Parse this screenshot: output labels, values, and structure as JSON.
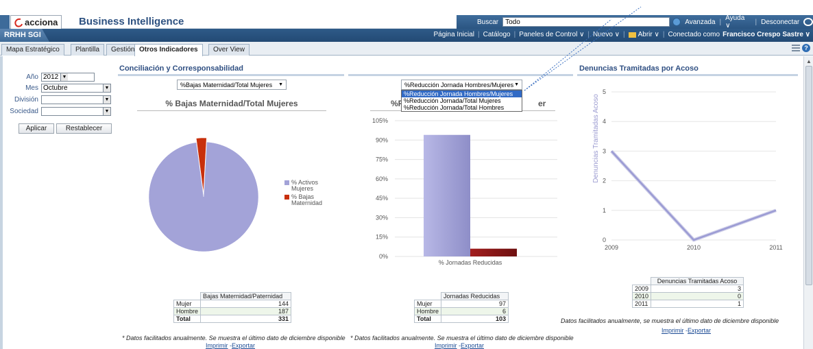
{
  "header": {
    "brand": "acciona",
    "app_title": "Business Intelligence",
    "search_label": "Buscar",
    "search_value": "Todo",
    "links": [
      "Avanzada",
      "Ayuda ∨",
      "Desconectar"
    ]
  },
  "navbar": {
    "section": "RRHH SGI",
    "links": [
      "Página Inicial",
      "Catálogo",
      "Paneles de Control ∨",
      "Nuevo ∨",
      "Abrir ∨"
    ],
    "connected_label": "Conectado como",
    "user": "Francisco Crespo Sastre ∨"
  },
  "tabs": [
    "Mapa Estratégico",
    "Plantilla",
    "Gestión",
    "Otros Indicadores",
    "Over View"
  ],
  "active_tab": "Otros Indicadores",
  "filters": {
    "anio": {
      "label": "Año",
      "value": "2012"
    },
    "mes": {
      "label": "Mes",
      "value": "Octubre"
    },
    "division": {
      "label": "División",
      "value": ""
    },
    "sociedad": {
      "label": "Sociedad",
      "value": ""
    },
    "apply": "Aplicar",
    "reset": "Restablecer"
  },
  "section1": {
    "title": "Conciliación y Corresponsabilidad",
    "selector": "%Bajas Maternidad/Total Mujeres",
    "chart_title": "% Bajas Maternidad/Total Mujeres",
    "legend": [
      "% Activos Mujeres",
      "% Bajas Maternidad"
    ],
    "table": {
      "header": "Bajas Maternidad/Paternidad",
      "rows": [
        {
          "label": "Mujer",
          "value": "144"
        },
        {
          "label": "Hombre",
          "value": "187"
        }
      ],
      "total_label": "Total",
      "total_value": "331"
    },
    "note": "* Datos facilitados anualmente. Se muestra el último dato de diciembre disponible",
    "print": "Imprimir",
    "export": "Exportar"
  },
  "section2": {
    "selector": "%Reducción Jornada Hombres/Mujeres",
    "options": [
      "%Reducción Jornada Hombres/Mujeres",
      "%Reducción Jornada/Total Mujeres",
      "%Reducción Jornada/Total Hombres"
    ],
    "chart_title_left": "%R",
    "chart_title_right": "er",
    "x_label": "% Jornadas Reducidas",
    "table": {
      "header": "Jornadas Reducidas",
      "rows": [
        {
          "label": "Mujer",
          "value": "97"
        },
        {
          "label": "Hombre",
          "value": "6"
        }
      ],
      "total_label": "Total",
      "total_value": "103"
    },
    "note": "* Datos facilitados anualmente. Se muestra el último dato de diciembre disponible",
    "print": "Imprimir",
    "export": "Exportar"
  },
  "section3": {
    "title": "Denuncias Tramitadas por Acoso",
    "ylabel": "Denuncias Tramitadas Acoso",
    "table": {
      "header": "Denuncias Tramitadas Acoso",
      "rows": [
        {
          "label": "2009",
          "value": "3"
        },
        {
          "label": "2010",
          "value": "0"
        },
        {
          "label": "2011",
          "value": "1"
        }
      ]
    },
    "note": "Datos facilitados anualmente, se muestra el último dato de diciembre disponible",
    "print": "Imprimir",
    "export": "Exportar"
  },
  "colors": {
    "lavender": "#a3a3d8",
    "dark_red": "#c8300c",
    "maroon": "#8e1a1a",
    "header_blue": "#2d5180"
  },
  "chart_data": [
    {
      "type": "pie",
      "title": "% Bajas Maternidad/Total Mujeres",
      "categories": [
        "% Activos Mujeres",
        "% Bajas Maternidad"
      ],
      "values": [
        97,
        3
      ]
    },
    {
      "type": "bar",
      "categories": [
        "% Jornadas Reducidas"
      ],
      "series": [
        {
          "values": [
            94
          ]
        },
        {
          "values": [
            6
          ]
        }
      ],
      "yticks": [
        "0%",
        "15%",
        "30%",
        "45%",
        "60%",
        "75%",
        "90%",
        "105%"
      ],
      "ylim": [
        0,
        105
      ]
    },
    {
      "type": "line",
      "title": "Denuncias Tramitadas por Acoso",
      "ylabel": "Denuncias Tramitadas Acoso",
      "x": [
        "2009",
        "2010",
        "2011"
      ],
      "values": [
        3,
        0,
        1
      ],
      "yticks": [
        "0",
        "1",
        "2",
        "3",
        "4",
        "5"
      ],
      "ylim": [
        0,
        5
      ]
    }
  ]
}
